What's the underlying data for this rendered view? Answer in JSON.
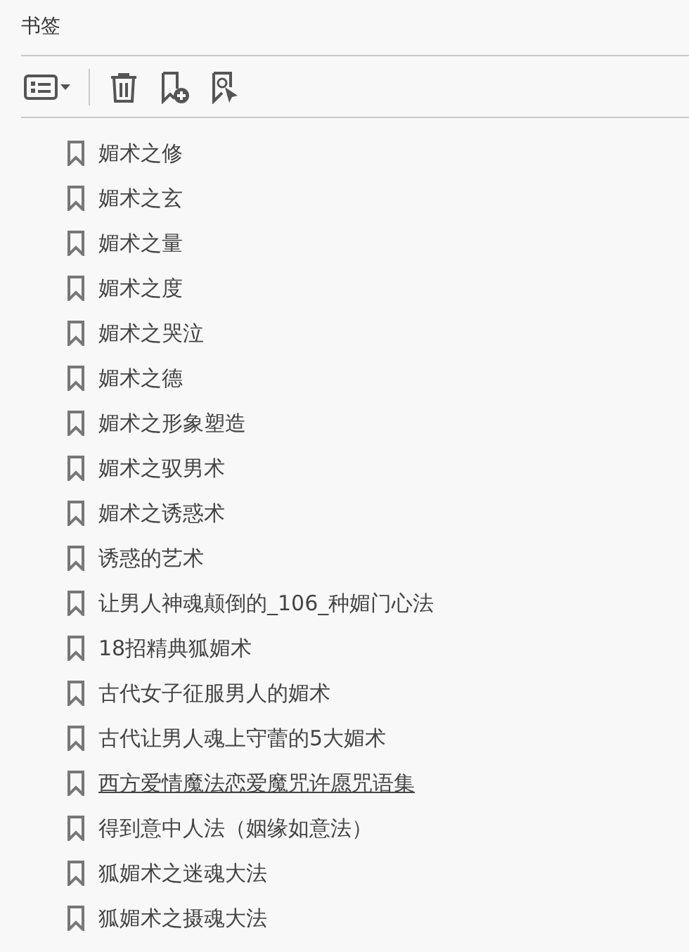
{
  "panel": {
    "title": "书签"
  },
  "bookmarks": [
    {
      "label": "媚术之修",
      "selected": false
    },
    {
      "label": "媚术之玄",
      "selected": false
    },
    {
      "label": "媚术之量",
      "selected": false
    },
    {
      "label": "媚术之度",
      "selected": false
    },
    {
      "label": "媚术之哭泣",
      "selected": false
    },
    {
      "label": "媚术之德",
      "selected": false
    },
    {
      "label": "媚术之形象塑造",
      "selected": false
    },
    {
      "label": "媚术之驭男术",
      "selected": false
    },
    {
      "label": "媚术之诱惑术",
      "selected": false
    },
    {
      "label": "诱惑的艺术",
      "selected": false
    },
    {
      "label": "让男人神魂颠倒的_106_种媚门心法",
      "selected": false
    },
    {
      "label": "18招精典狐媚术",
      "selected": false
    },
    {
      "label": "古代女子征服男人的媚术",
      "selected": false
    },
    {
      "label": "古代让男人魂上守蕾的5大媚术",
      "selected": false
    },
    {
      "label": "西方爱情魔法恋爱魔咒许愿咒语集",
      "selected": true
    },
    {
      "label": "得到意中人法（姻缘如意法）",
      "selected": false
    },
    {
      "label": "狐媚术之迷魂大法",
      "selected": false
    },
    {
      "label": "狐媚术之摄魂大法",
      "selected": false
    }
  ]
}
